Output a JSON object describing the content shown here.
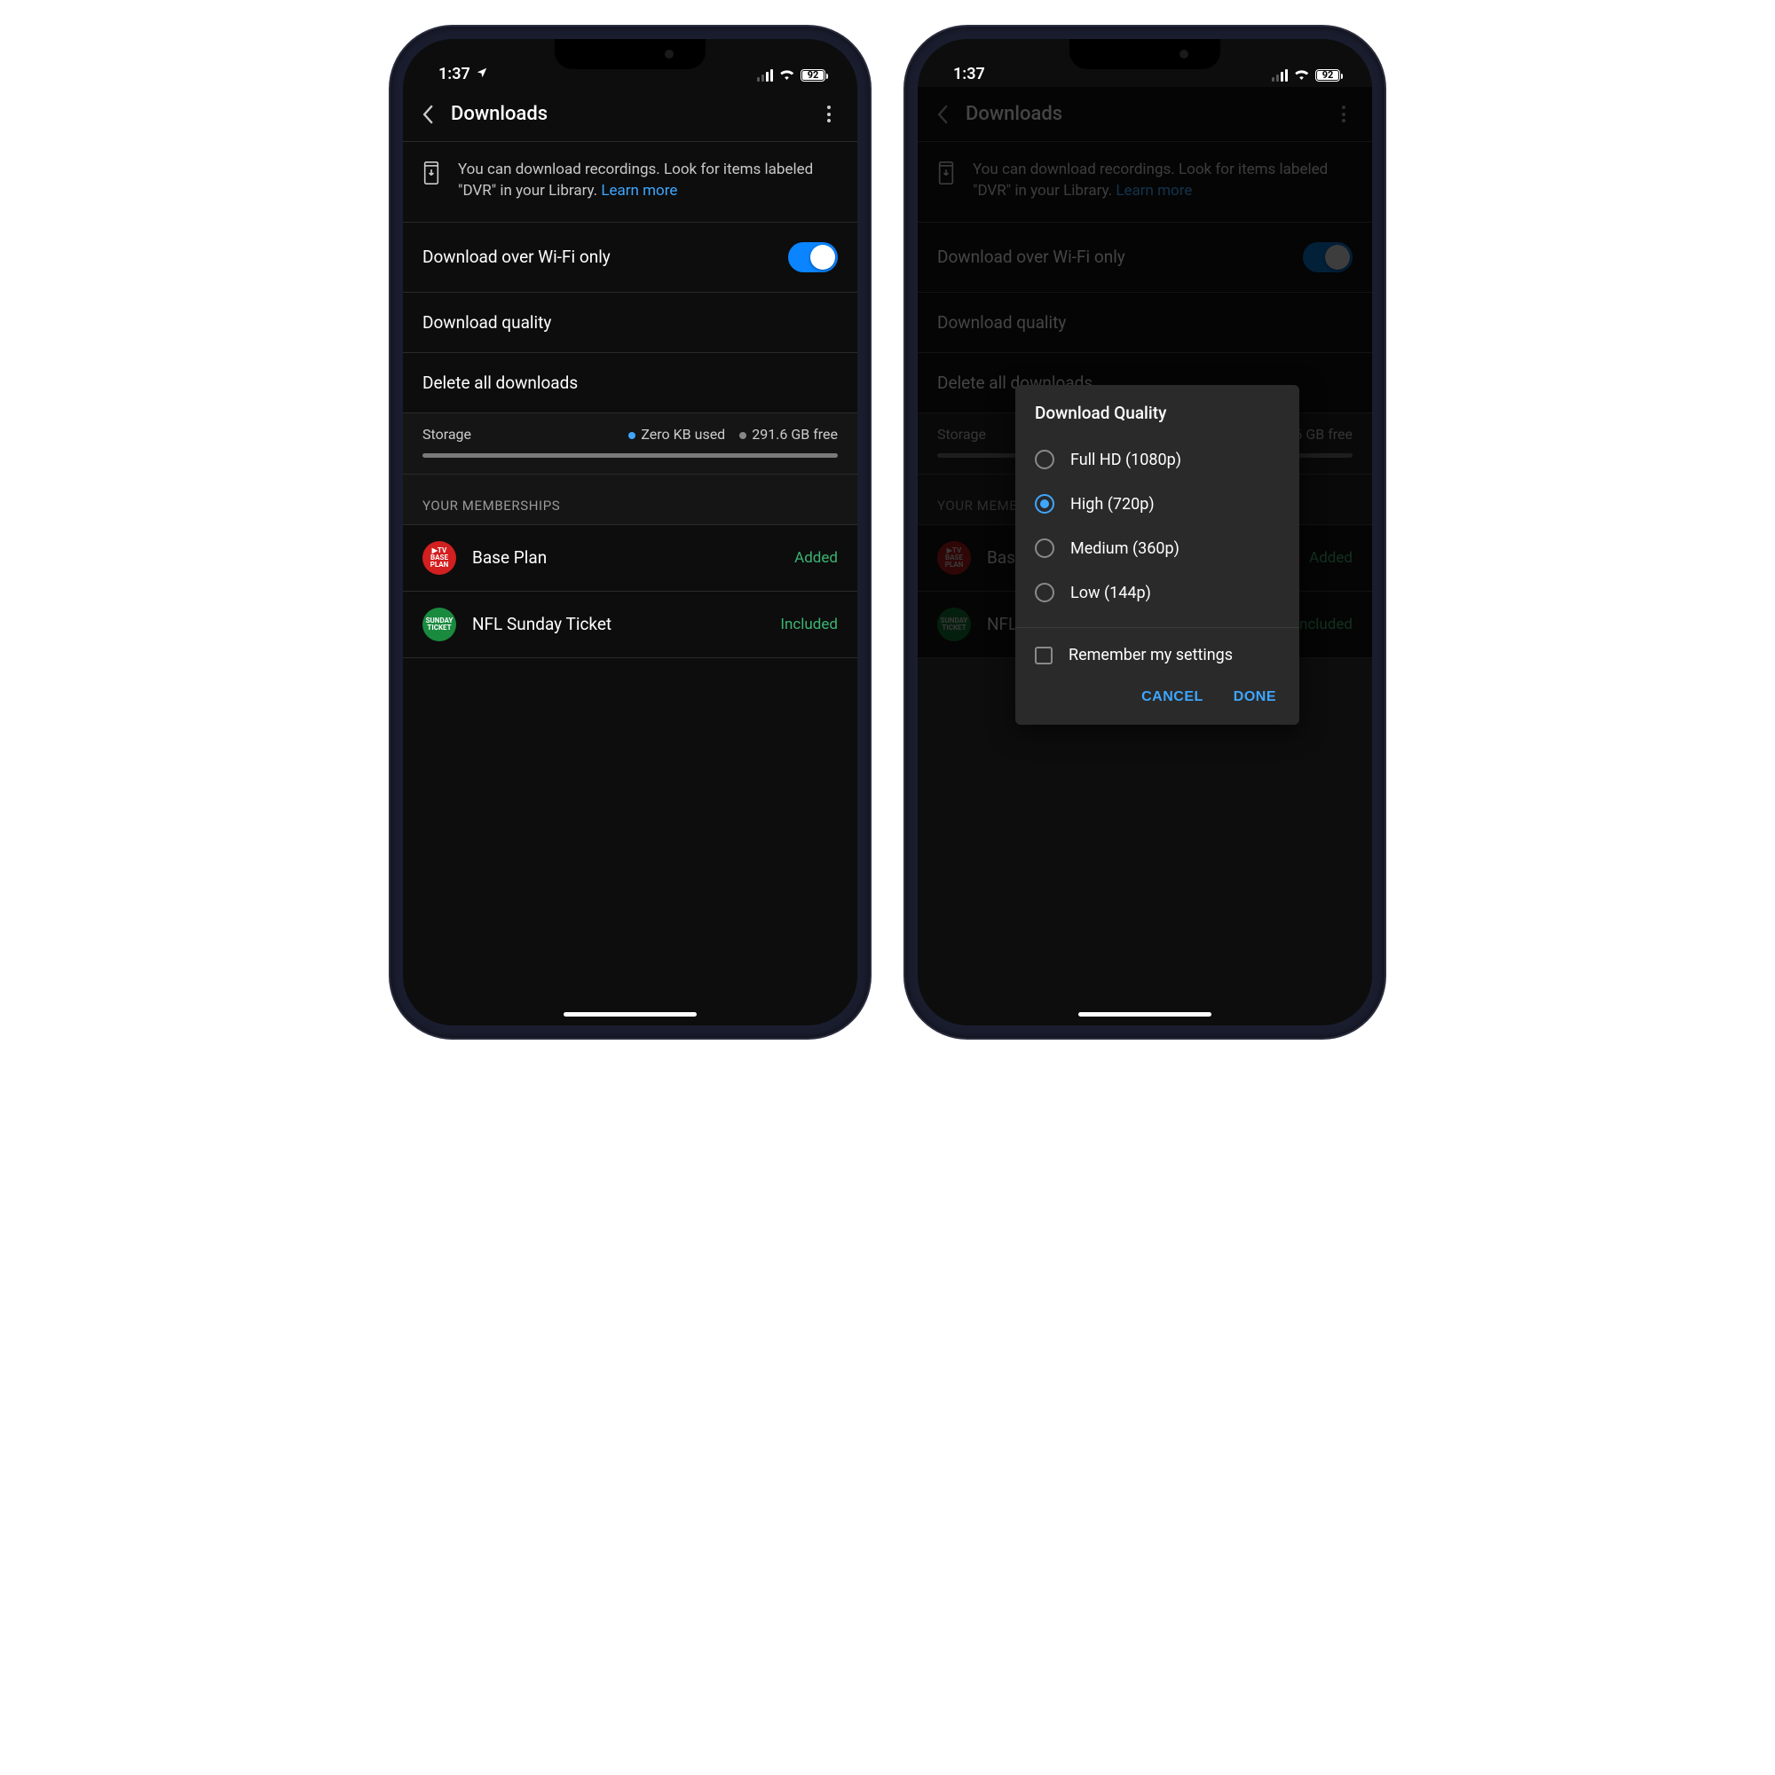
{
  "status": {
    "time": "1:37",
    "battery": "92"
  },
  "header": {
    "title": "Downloads"
  },
  "banner": {
    "text": "You can download recordings. Look for items labeled \"DVR\" in your Library. ",
    "link": "Learn more"
  },
  "settings": {
    "wifi_only": "Download over Wi-Fi only",
    "quality": "Download quality",
    "delete_all": "Delete all downloads"
  },
  "storage": {
    "label": "Storage",
    "used": "Zero KB used",
    "free": "291.6 GB free"
  },
  "memberships": {
    "section": "YOUR MEMBERSHIPS",
    "items": [
      {
        "name": "Base Plan",
        "status": "Added",
        "icon": "yttv-base"
      },
      {
        "name": "NFL Sunday Ticket",
        "status": "Included",
        "icon": "sunday-ticket"
      }
    ]
  },
  "dialog": {
    "title": "Download Quality",
    "options": [
      {
        "label": "Full HD (1080p)",
        "selected": false
      },
      {
        "label": "High (720p)",
        "selected": true
      },
      {
        "label": "Medium (360p)",
        "selected": false
      },
      {
        "label": "Low (144p)",
        "selected": false
      }
    ],
    "remember": "Remember my settings",
    "cancel": "CANCEL",
    "done": "DONE"
  }
}
